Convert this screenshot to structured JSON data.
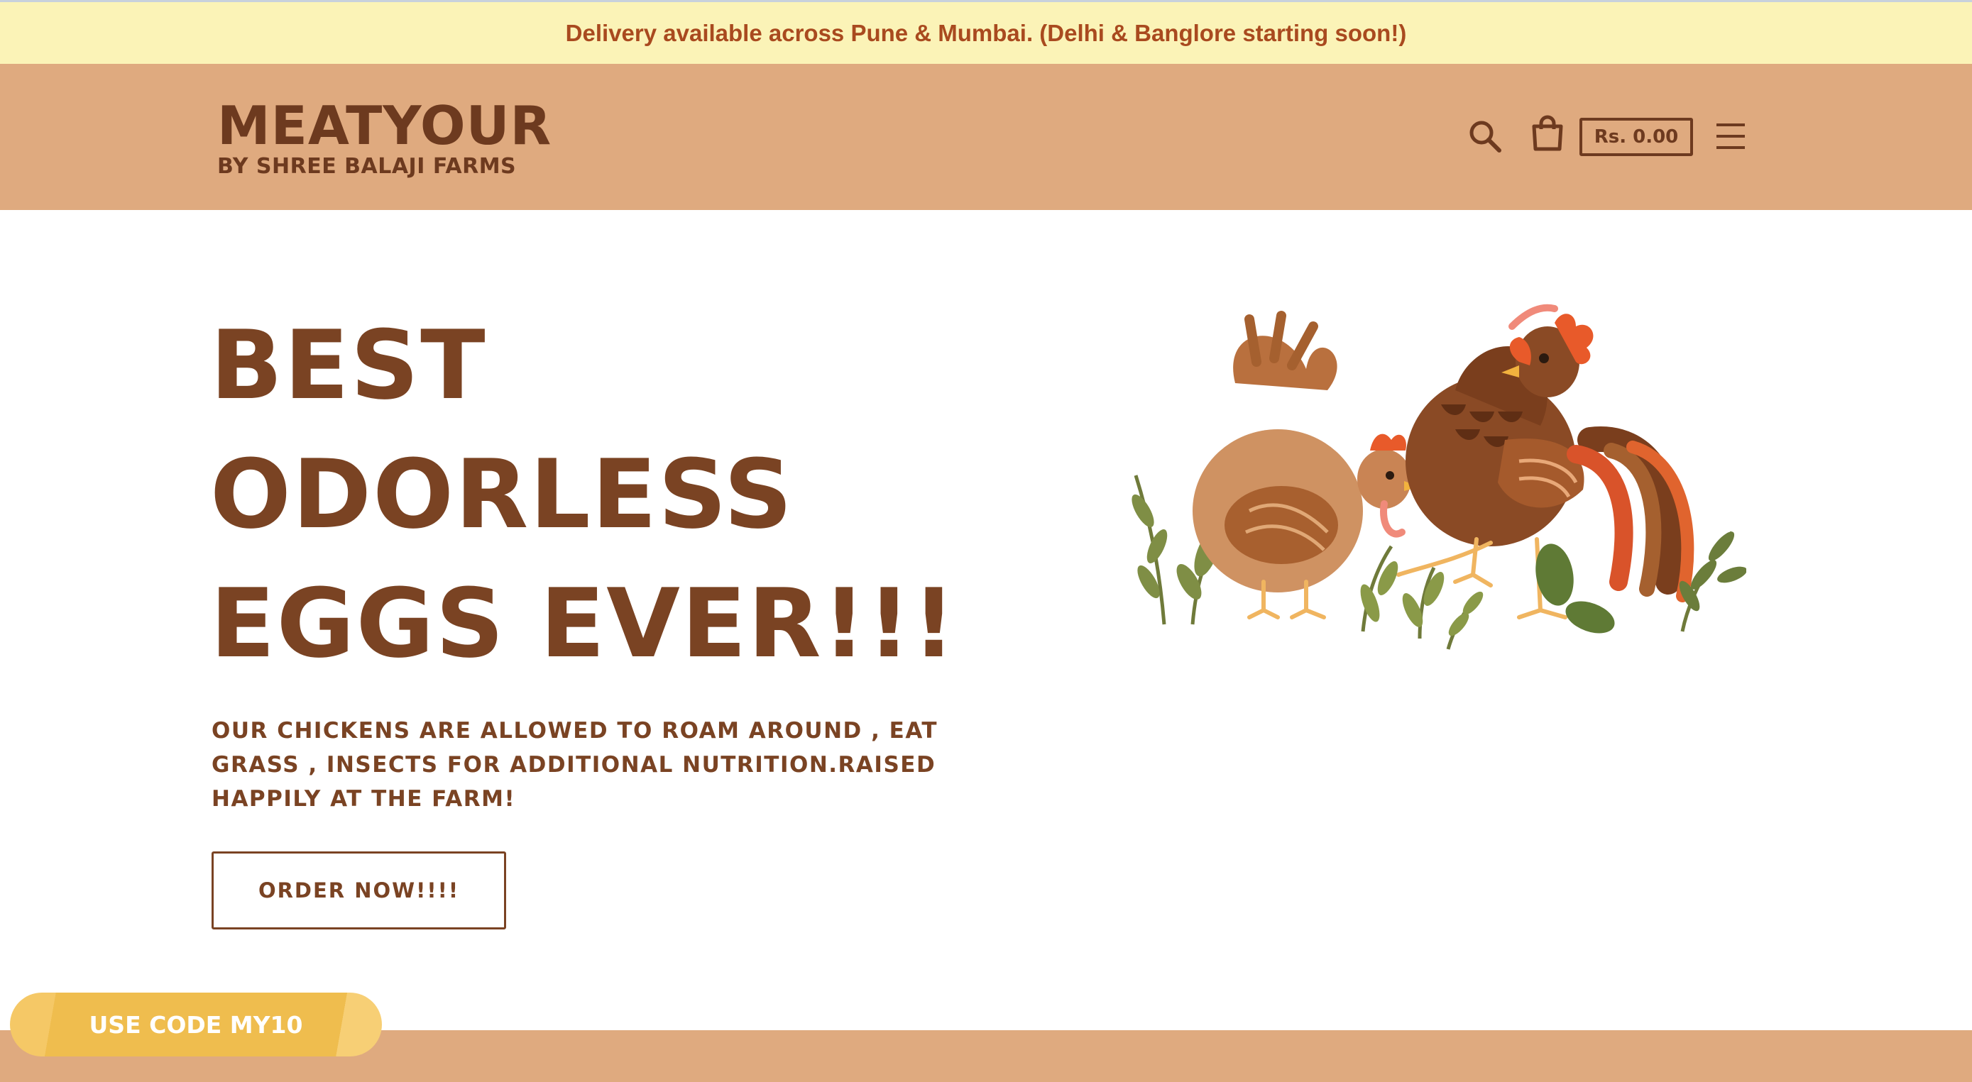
{
  "announcement": {
    "text": "Delivery available across Pune & Mumbai. (Delhi & Banglore starting soon!)"
  },
  "header": {
    "logo_main": "MEATYOUR",
    "logo_sub": "BY SHREE BALAJI FARMS",
    "cart_total": "Rs. 0.00",
    "icons": [
      "search-icon",
      "shopping-bag-icon",
      "hamburger-menu-icon"
    ]
  },
  "hero": {
    "title_lines": [
      "BEST",
      "ODORLESS",
      "EGGS EVER!!!"
    ],
    "subtitle": "OUR CHICKENS ARE ALLOWED TO ROAM AROUND , EAT GRASS , INSECTS FOR ADDITIONAL NUTRITION.RAISED HAPPILY AT THE FARM!",
    "cta_label": "ORDER NOW!!!!"
  },
  "promo": {
    "label": "USE CODE MY10"
  },
  "colors": {
    "brand_brown": "#7a4323",
    "header_bg": "#dfaa7f",
    "announcement_bg": "#fbf3b7",
    "announcement_text": "#a94a1f",
    "promo_bg": "#efbd4e"
  }
}
